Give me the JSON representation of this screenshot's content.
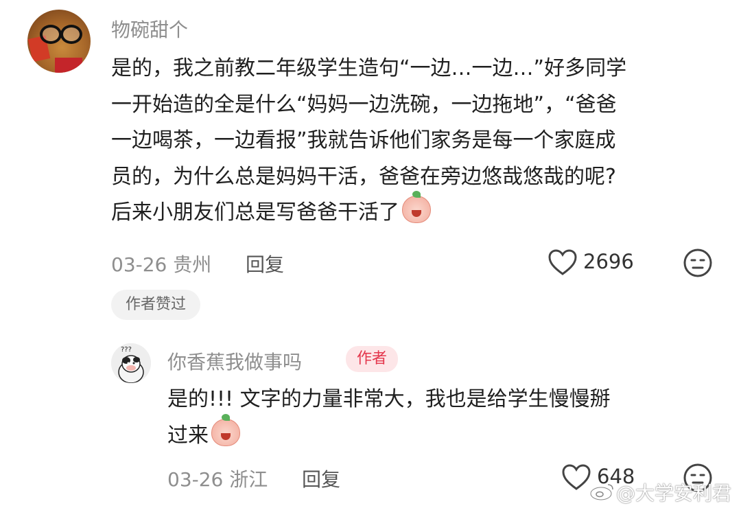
{
  "comment": {
    "username": "物碗甜个",
    "text_lines": [
      "是的，我之前教二年级学生造句“一边…一边…”好多同学",
      "一开始造的全是什么“妈妈一边洗碗，一边拖地”，“爸爸",
      "一边喝茶，一边看报”我就告诉他们家务是每一个家庭成",
      "员的，为什么总是妈妈干活，爸爸在旁边悠哉悠哉的呢?",
      "后来小朋友们总是写爸爸干活了"
    ],
    "date_location": "03-26 贵州",
    "reply_label": "回复",
    "likes": "2696",
    "author_liked_pill": "作者赞过"
  },
  "reply": {
    "username": "你香蕉我做事吗",
    "author_tag": "作者",
    "text_lines": [
      "是的!!! 文字的力量非常大，我也是给学生慢慢掰",
      "过来"
    ],
    "date_location": "03-26 浙江",
    "reply_label": "回复",
    "likes": "648"
  },
  "watermark": "@大学安利君",
  "icons": {
    "like": "heart-outline-icon",
    "dislike": "neutral-face-icon",
    "emoji_cry_laugh": "peach-laugh-cry-emoji",
    "emoji_cover_mouth": "peach-cover-mouth-emoji",
    "weibo": "weibo-logo-icon"
  },
  "colors": {
    "author_tag_bg": "#fde6e8",
    "author_tag_text": "#e4364c",
    "meta_text": "#8e8e8e"
  }
}
